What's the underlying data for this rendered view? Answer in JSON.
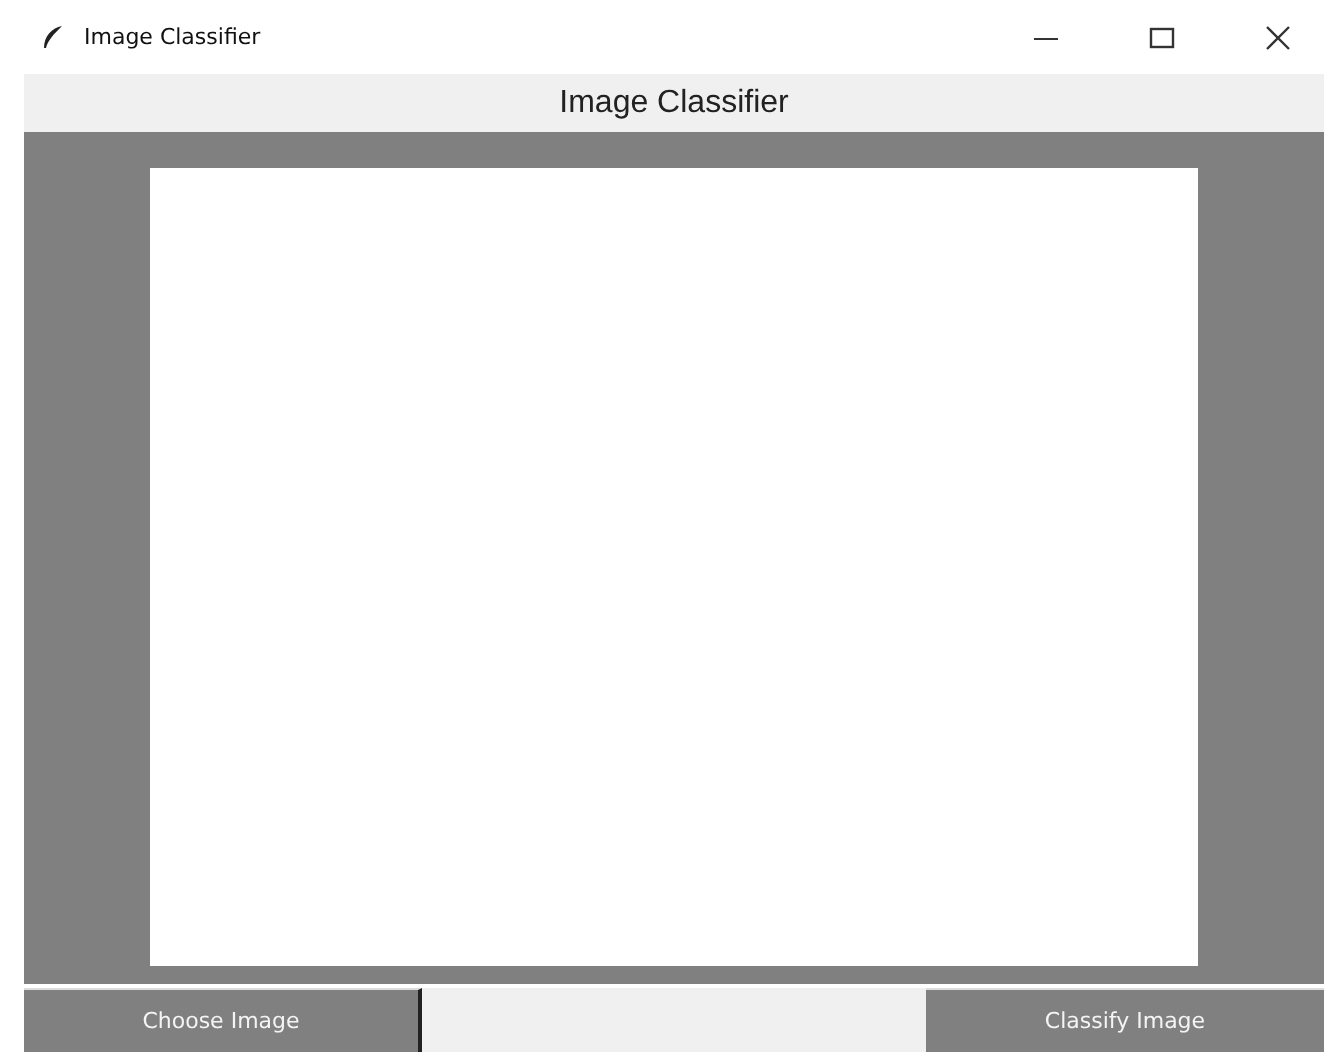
{
  "window": {
    "title": "Image Classifier"
  },
  "header": {
    "title": "Image Classifier"
  },
  "buttons": [
    {
      "label": "Choose Image"
    },
    {
      "label": "Classify Image"
    }
  ]
}
